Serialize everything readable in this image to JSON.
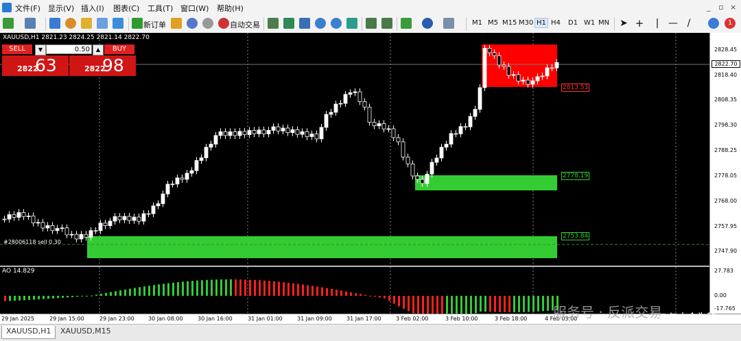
{
  "menu": {
    "items": [
      "文件(F)",
      "显示(V)",
      "插入(I)",
      "图表(C)",
      "工具(T)",
      "窗口(W)",
      "帮助(H)"
    ],
    "window_controls": [
      "_",
      "▫",
      "×"
    ]
  },
  "toolbar": {
    "new_order_label": "新订单",
    "autotrade_label": "自动交易",
    "timeframes": [
      "M1",
      "M5",
      "M15",
      "M30",
      "H1",
      "H4",
      "D1",
      "W1",
      "MN"
    ],
    "active_timeframe": "H1",
    "notification_count": "1"
  },
  "chart": {
    "symbol_label": "XAUUSD,H1  2821.23 2824.25 2821.14 2822.70",
    "current_price": "2822.70",
    "y_ticks": [
      "2828.45",
      "2818.40",
      "2808.35",
      "2798.30",
      "2788.25",
      "2778.05",
      "2768.00",
      "2757.95",
      "2747.90"
    ],
    "order_line_label": "#28006118 sell 0.30",
    "zone_labels": {
      "red": "2813.53",
      "green_upper": "2778.19",
      "green_lower": "2753.84"
    },
    "colors": {
      "bull": "#ffffff",
      "bear": "#000000",
      "supply_zone": "#ff0000",
      "demand_zone": "#33cc33",
      "order_line": "#2e8b2e"
    }
  },
  "trade_panel": {
    "sell_label": "SELL",
    "buy_label": "BUY",
    "lot": "0.50",
    "sell_price_small": "2822",
    "sell_price_big": "63",
    "buy_price_small": "2822",
    "buy_price_big": "98"
  },
  "ao": {
    "label": "AO 14.829",
    "top_value": "27.783",
    "zero_value": "0.00",
    "bottom_value": "-17.765"
  },
  "time_axis": [
    "29 Jan 2025",
    "29 Jan 15:00",
    "29 Jan 23:00",
    "30 Jan 08:00",
    "30 Jan 16:00",
    "31 Jan 01:00",
    "31 Jan 09:00",
    "31 Jan 17:00",
    "3 Feb 02:00",
    "3 Feb 10:00",
    "3 Feb 18:00",
    "4 Feb 03:00"
  ],
  "tabs": [
    "XAUUSD,H1",
    "XAUUSD,M15"
  ],
  "watermark": {
    "text": "服务号 · 反派交易",
    "badge": "@与大众为敌"
  }
}
